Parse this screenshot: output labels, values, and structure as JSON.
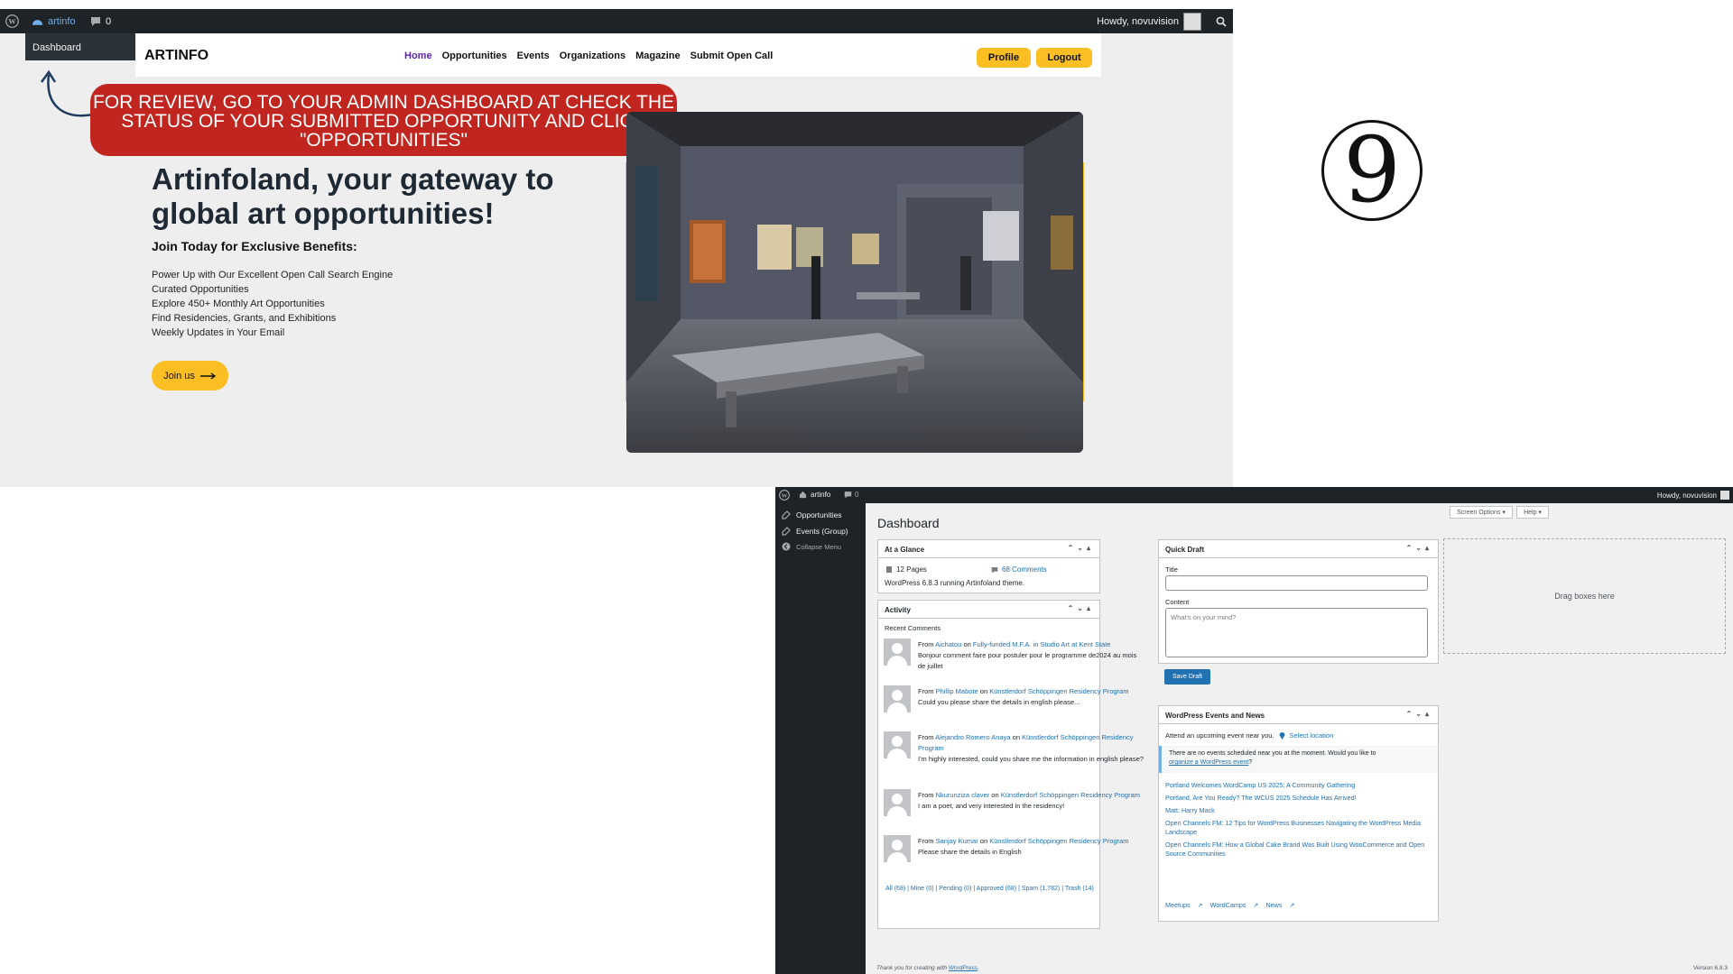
{
  "top": {
    "admin_bar": {
      "site_name": "artinfo",
      "comments_count": "0",
      "howdy": "Howdy, novuvision",
      "dashboard_item": "Dashboard"
    },
    "site": {
      "logo": "ARTINFO",
      "nav": [
        "Home",
        "Opportunities",
        "Events",
        "Organizations",
        "Magazine",
        "Submit Open Call"
      ],
      "profile_label": "Profile",
      "logout_label": "Logout"
    },
    "banner": {
      "line1": "FOR REVIEW, GO TO YOUR ADMIN DASHBOARD AT CHECK THE",
      "line2": "STATUS OF YOUR SUBMITTED OPPORTUNITY AND CLICK",
      "line3": "\"OPPORTUNITIES\""
    },
    "hero": {
      "title": "Artinfoland, your gateway to global art opportunities!",
      "subtitle": "Join Today for Exclusive Benefits:",
      "benefits": [
        "Power Up with Our Excellent Open Call Search Engine",
        "Curated Opportunities",
        "Explore 450+ Monthly Art Opportunities",
        "Find Residencies, Grants, and Exhibitions",
        "Weekly Updates in Your Email"
      ],
      "join_label": "Join us"
    }
  },
  "step_number": "9",
  "wp": {
    "admin_bar": {
      "site_name": "artinfo",
      "comments_count": "0",
      "howdy": "Howdy, novuvision"
    },
    "sidebar": [
      "Opportunities",
      "Events (Group)",
      "Collapse Menu"
    ],
    "page_title": "Dashboard",
    "screen_options": "Screen Options",
    "help": "Help",
    "glance": {
      "title": "At a Glance",
      "pages": "12 Pages",
      "comments": "68 Comments",
      "running": "WordPress 6.8.3 running Artinfoland theme."
    },
    "activity": {
      "title": "Activity",
      "recent": "Recent Comments",
      "comments": [
        {
          "author": "Aichatou",
          "post": "Fully-funded M.F.A. in Studio Art at Kent State",
          "text": "Bonjour comment faire pour postuler pour le programme de2024 au mois de juillet"
        },
        {
          "author": "Phillip Mabote",
          "post": "Künstlerdorf Schöppingen Residency Program",
          "text": "Could you please share the details in english please..."
        },
        {
          "author": "Alejandro Romero Anaya",
          "post": "Künstlerdorf Schöppingen Residency Program",
          "text": "I'm highly interested, could you share me the information in english please?"
        },
        {
          "author": "Nkurunziza claver",
          "post": "Künstlerdorf Schöppingen Residency Program",
          "text": "I am a poet, and very interested in the residency!"
        },
        {
          "author": "Sanjay Kumar",
          "post": "Künstlerdorf Schöppingen Residency Program",
          "text": "Please share the details in English"
        }
      ],
      "filters": "All (68) | Mine (0) | Pending (0) | Approved (68) | Spam (1,782) | Trash (14)"
    },
    "quick_draft": {
      "title": "Quick Draft",
      "title_label": "Title",
      "content_label": "Content",
      "content_placeholder": "What's on your mind?",
      "save_label": "Save Draft"
    },
    "events": {
      "title": "WordPress Events and News",
      "attend": "Attend an upcoming event near you.",
      "select_location": "Select location",
      "notice1": "There are no events scheduled near you at the moment. Would you like to",
      "notice_link": "organize a WordPress event",
      "news": [
        "Portland Welcomes WordCamp US 2025: A Community Gathering",
        "Portland, Are You Ready? The WCUS 2025 Schedule Has Arrived!",
        "Matt: Harry Mack",
        "Open Channels FM: 12 Tips for WordPress Businesses Navigating the WordPress Media Landscape",
        "Open Channels FM: How a Global Cake Brand Was Built Using WooCommerce and Open Source Communities"
      ],
      "footer_links": [
        "Meetups",
        "WordCamps",
        "News"
      ]
    },
    "drag_boxes": "Drag boxes here",
    "footer_thanks": "Thank you for creating with",
    "footer_wp": "WordPress",
    "version": "Version 6.8.3"
  }
}
